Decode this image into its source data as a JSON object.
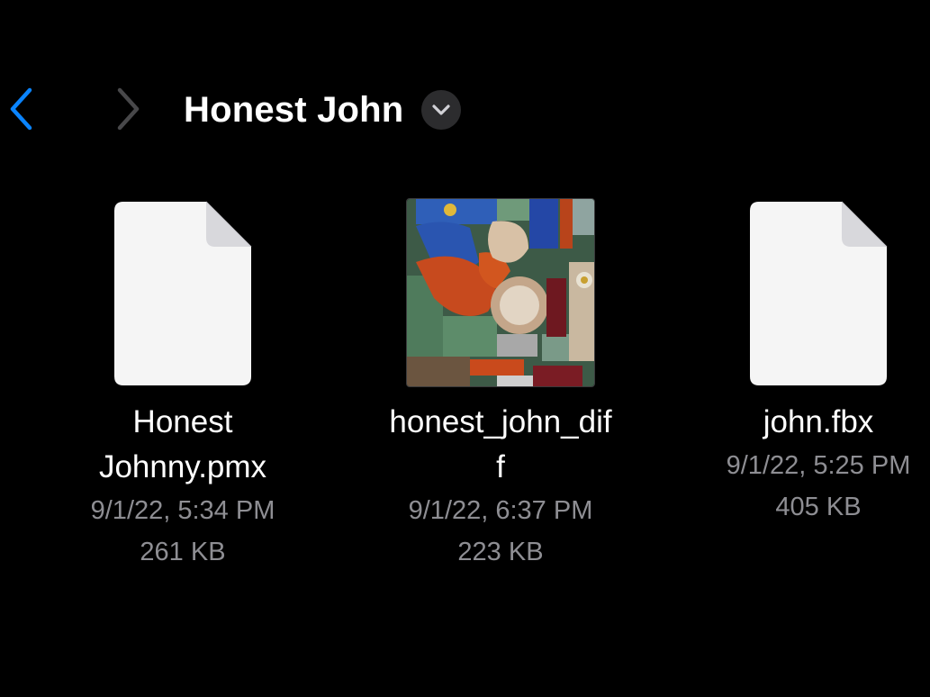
{
  "header": {
    "title": "Honest John",
    "back_icon": "chevron-left-icon",
    "forward_icon": "chevron-right-icon",
    "menu_icon": "chevron-down-icon",
    "accent_color": "#0a84ff",
    "disabled_color": "#48484a"
  },
  "files": [
    {
      "name_line1": "Honest",
      "name_line2": "Johnny.pmx",
      "date": "9/1/22, 5:34 PM",
      "size": "261 KB",
      "icon": "document-icon"
    },
    {
      "name_line1": "honest_john_dif",
      "name_line2": "f",
      "date": "9/1/22, 6:37 PM",
      "size": "223 KB",
      "icon": "image-thumbnail"
    },
    {
      "name_line1": "john.fbx",
      "name_line2": "",
      "date": "9/1/22, 5:25 PM",
      "size": "405 KB",
      "icon": "document-icon"
    }
  ],
  "colors": {
    "background": "#000000",
    "text_primary": "#ffffff",
    "text_secondary": "#8e8e93",
    "document_fill": "#f5f5f5"
  }
}
